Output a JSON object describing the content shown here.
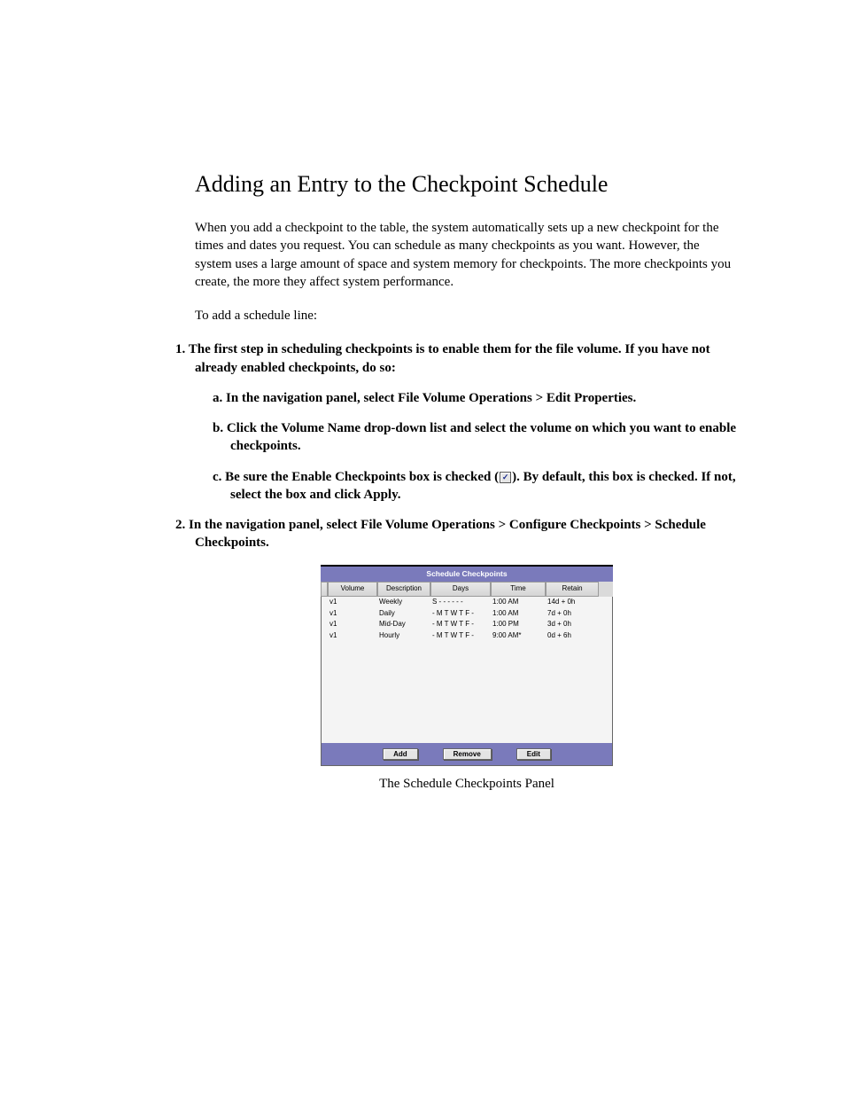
{
  "heading": "Adding an Entry to the Checkpoint Schedule",
  "para1": "When you add a checkpoint to the table, the system automatically sets up a new checkpoint for the times and dates you request. You can schedule as many checkpoints as you want. However, the system uses a large amount of space and system memory for checkpoints. The more checkpoints you create, the more they affect system performance.",
  "para2": "To add a schedule line:",
  "steps": {
    "s1_num": "1.",
    "s1": "The first step in scheduling checkpoints is to enable them for the file volume. If you have not already enabled checkpoints, do so:",
    "s1a_num": "a.",
    "s1a": "In the navigation panel, select File Volume Operations > Edit Properties.",
    "s1b_num": "b.",
    "s1b": "Click the Volume Name drop-down list and select the volume on which you want to enable checkpoints.",
    "s1c_num": "c.",
    "s1c_before": "Be sure the Enable Checkpoints box is checked (",
    "s1c_after": "). By default, this box is checked. If not, select the box and click Apply.",
    "s2_num": "2.",
    "s2": "In the navigation panel, select File Volume Operations > Configure Checkpoints > Schedule Checkpoints."
  },
  "panel": {
    "title": "Schedule Checkpoints",
    "headers": {
      "vol": "Volume",
      "desc": "Description",
      "days": "Days",
      "time": "Time",
      "ret": "Retain"
    },
    "rows": [
      {
        "vol": "v1",
        "desc": "Weekly",
        "days": "S - - - - - -",
        "time": "1:00 AM",
        "ret": "14d +  0h"
      },
      {
        "vol": "v1",
        "desc": "Daily",
        "days": "- M T W T F -",
        "time": "1:00 AM",
        "ret": " 7d +  0h"
      },
      {
        "vol": "v1",
        "desc": "Mid-Day",
        "days": "- M T W T F -",
        "time": "1:00 PM",
        "ret": " 3d +  0h"
      },
      {
        "vol": "v1",
        "desc": "Hourly",
        "days": "- M T W T F -",
        "time": "9:00 AM*",
        "ret": " 0d +  6h"
      }
    ],
    "buttons": {
      "add": "Add",
      "remove": "Remove",
      "edit": "Edit"
    }
  },
  "caption": "The Schedule Checkpoints Panel",
  "checkbox_glyph": "✓"
}
